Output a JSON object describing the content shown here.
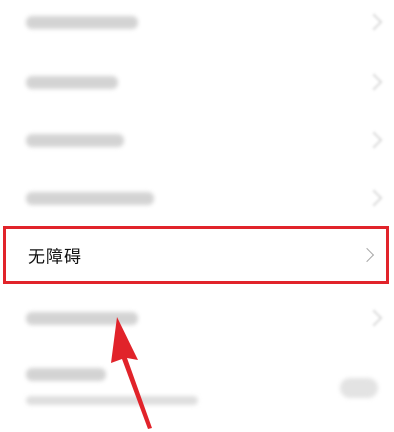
{
  "settings": {
    "highlighted_item": {
      "label": "无障碍"
    }
  },
  "annotation": {
    "highlight_color": "#e1232a",
    "arrow_color": "#e1232a"
  },
  "icons": {
    "chevron": "chevron-right-icon"
  }
}
